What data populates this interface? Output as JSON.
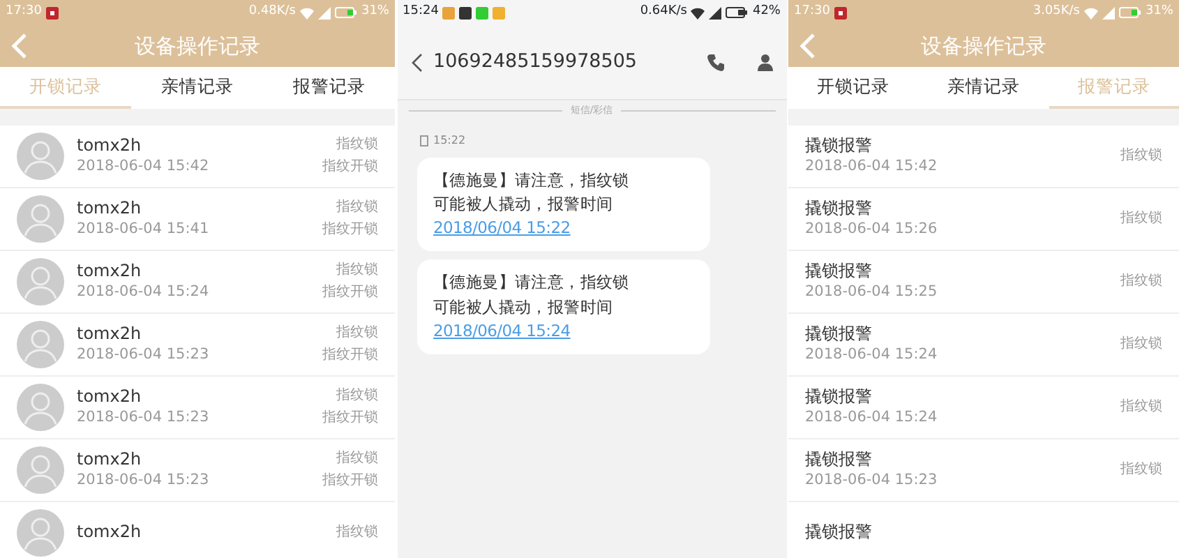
{
  "panels": [
    {
      "kind": "records",
      "status_bar": {
        "time": "17:30",
        "speed": "0.48K/s",
        "battery": "31%"
      },
      "title": "设备操作记录",
      "tabs": [
        {
          "label": "开锁记录",
          "selected": true
        },
        {
          "label": "亲情记录",
          "selected": false
        },
        {
          "label": "报警记录",
          "selected": false
        }
      ],
      "rows": [
        {
          "kind": "user",
          "name": "tomx2h",
          "time": "2018-06-04 15:42",
          "device": "指纹锁",
          "action": "指纹开锁"
        },
        {
          "kind": "user",
          "name": "tomx2h",
          "time": "2018-06-04 15:41",
          "device": "指纹锁",
          "action": "指纹开锁"
        },
        {
          "kind": "user",
          "name": "tomx2h",
          "time": "2018-06-04 15:24",
          "device": "指纹锁",
          "action": "指纹开锁"
        },
        {
          "kind": "user",
          "name": "tomx2h",
          "time": "2018-06-04 15:23",
          "device": "指纹锁",
          "action": "指纹开锁"
        },
        {
          "kind": "user",
          "name": "tomx2h",
          "time": "2018-06-04 15:23",
          "device": "指纹锁",
          "action": "指纹开锁"
        },
        {
          "kind": "user",
          "name": "tomx2h",
          "time": "2018-06-04 15:23",
          "device": "指纹锁",
          "action": "指纹开锁"
        },
        {
          "kind": "user",
          "name": "tomx2h",
          "device": "指纹锁"
        }
      ]
    },
    {
      "kind": "sms",
      "status_bar": {
        "time": "15:24",
        "speed": "0.64K/s",
        "battery": "42%"
      },
      "title": "10692485159978505",
      "divider": "短信/彩信",
      "stamp": "15:22",
      "messages": [
        {
          "text": "【德施曼】请注意，指纹锁可能被人撬动，报警时间",
          "link": "2018/06/04 15:22"
        },
        {
          "text": "【德施曼】请注意，指纹锁可能被人撬动，报警时间",
          "link": "2018/06/04 15:24"
        }
      ]
    },
    {
      "kind": "records",
      "status_bar": {
        "time": "17:30",
        "speed": "3.05K/s",
        "battery": "31%"
      },
      "title": "设备操作记录",
      "tabs": [
        {
          "label": "开锁记录",
          "selected": false
        },
        {
          "label": "亲情记录",
          "selected": false
        },
        {
          "label": "报警记录",
          "selected": true
        }
      ],
      "rows": [
        {
          "kind": "alarm",
          "name": "撬锁报警",
          "time": "2018-06-04 15:42",
          "device": "指纹锁"
        },
        {
          "kind": "alarm",
          "name": "撬锁报警",
          "time": "2018-06-04 15:26",
          "device": "指纹锁"
        },
        {
          "kind": "alarm",
          "name": "撬锁报警",
          "time": "2018-06-04 15:25",
          "device": "指纹锁"
        },
        {
          "kind": "alarm",
          "name": "撬锁报警",
          "time": "2018-06-04 15:24",
          "device": "指纹锁"
        },
        {
          "kind": "alarm",
          "name": "撬锁报警",
          "time": "2018-06-04 15:24",
          "device": "指纹锁"
        },
        {
          "kind": "alarm",
          "name": "撬锁报警",
          "time": "2018-06-04 15:23",
          "device": "指纹锁"
        },
        {
          "kind": "alarm",
          "name": "撬锁报警"
        }
      ]
    }
  ]
}
